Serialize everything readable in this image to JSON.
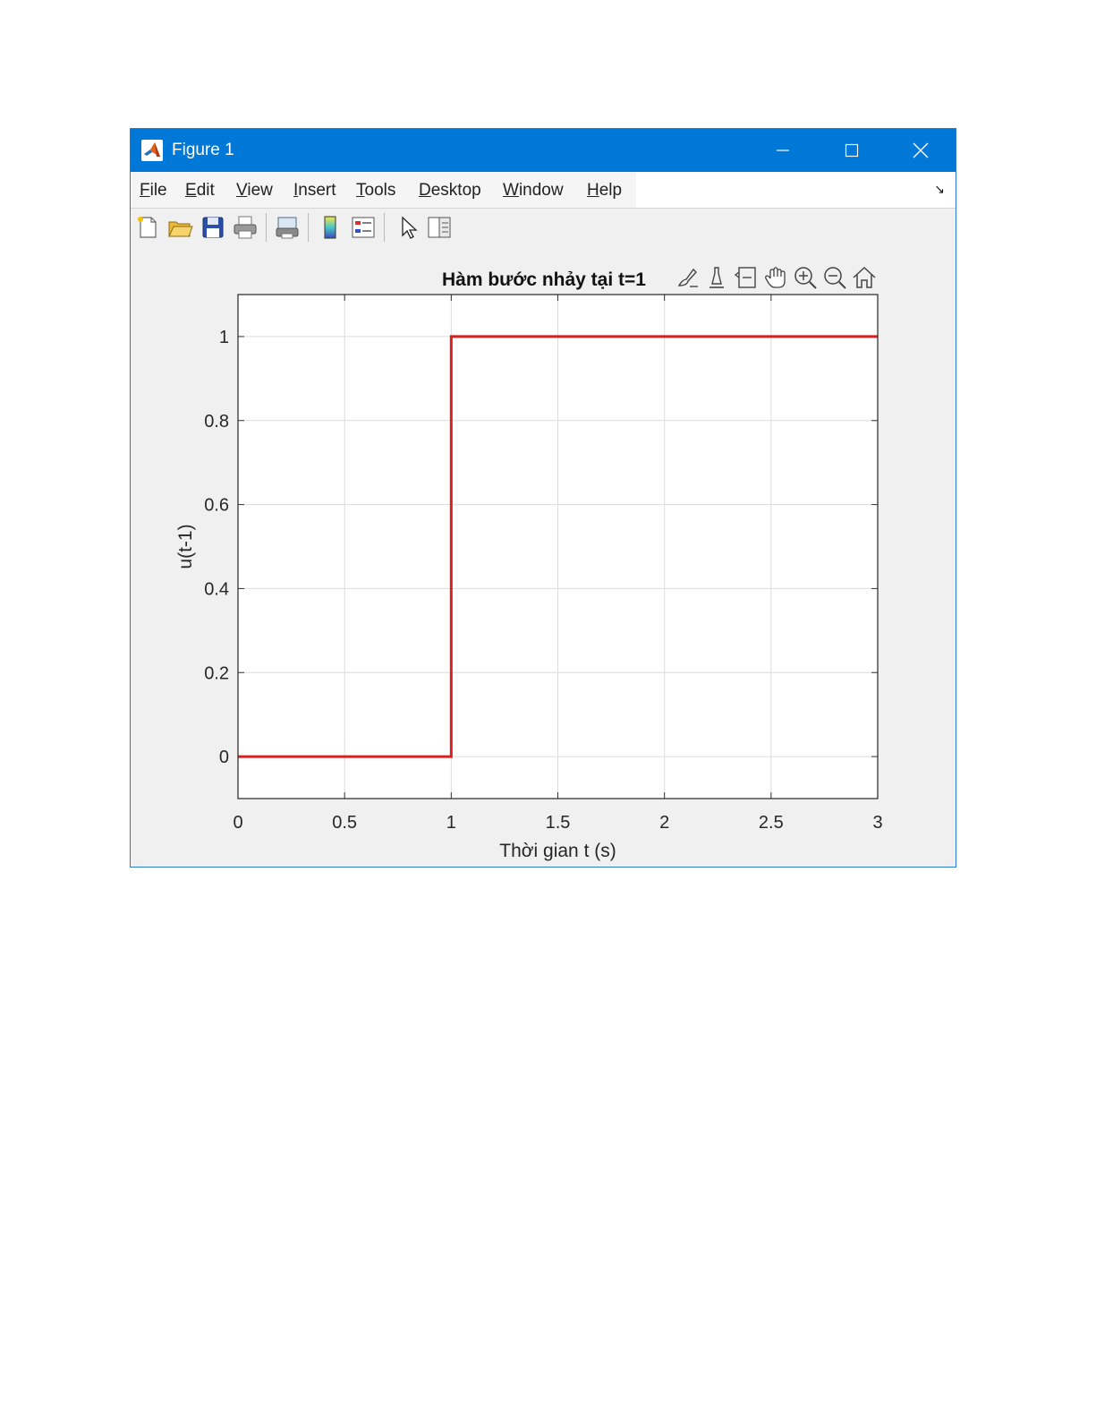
{
  "window": {
    "title": "Figure 1",
    "title_bar_color": "#0078d7"
  },
  "window_controls": {
    "minimize_icon": "minimize-icon",
    "maximize_icon": "maximize-icon",
    "close_icon": "close-icon"
  },
  "menu": {
    "items": [
      "File",
      "Edit",
      "View",
      "Insert",
      "Tools",
      "Desktop",
      "Window",
      "Help"
    ]
  },
  "toolbar": {
    "buttons": [
      "new-figure-icon",
      "open-file-icon",
      "save-icon",
      "print-icon",
      "print-preview-icon",
      "colorbar-icon",
      "legend-icon",
      "edit-plot-arrow-icon",
      "property-inspector-icon"
    ]
  },
  "axes_toolbar": {
    "buttons": [
      "brush-icon",
      "data-tips-icon",
      "restore-view-list-icon",
      "pan-hand-icon",
      "zoom-in-icon",
      "zoom-out-icon",
      "home-icon"
    ]
  },
  "chart_data": {
    "type": "line",
    "title": "Hàm bước nhảy tại t=1",
    "xlabel": "Thời gian t (s)",
    "ylabel": "u(t-1)",
    "xlim": [
      0,
      3
    ],
    "ylim": [
      -0.1,
      1.1
    ],
    "xticks": [
      0,
      0.5,
      1,
      1.5,
      2,
      2.5,
      3
    ],
    "xtick_labels": [
      "0",
      "0.5",
      "1",
      "1.5",
      "2",
      "2.5",
      "3"
    ],
    "yticks": [
      0,
      0.2,
      0.4,
      0.6,
      0.8,
      1
    ],
    "ytick_labels": [
      "0",
      "0.2",
      "0.4",
      "0.6",
      "0.8",
      "1"
    ],
    "grid": true,
    "series": [
      {
        "color": "#d62020",
        "x": [
          0,
          1,
          1,
          3
        ],
        "y": [
          0,
          0,
          1,
          1
        ]
      }
    ]
  }
}
